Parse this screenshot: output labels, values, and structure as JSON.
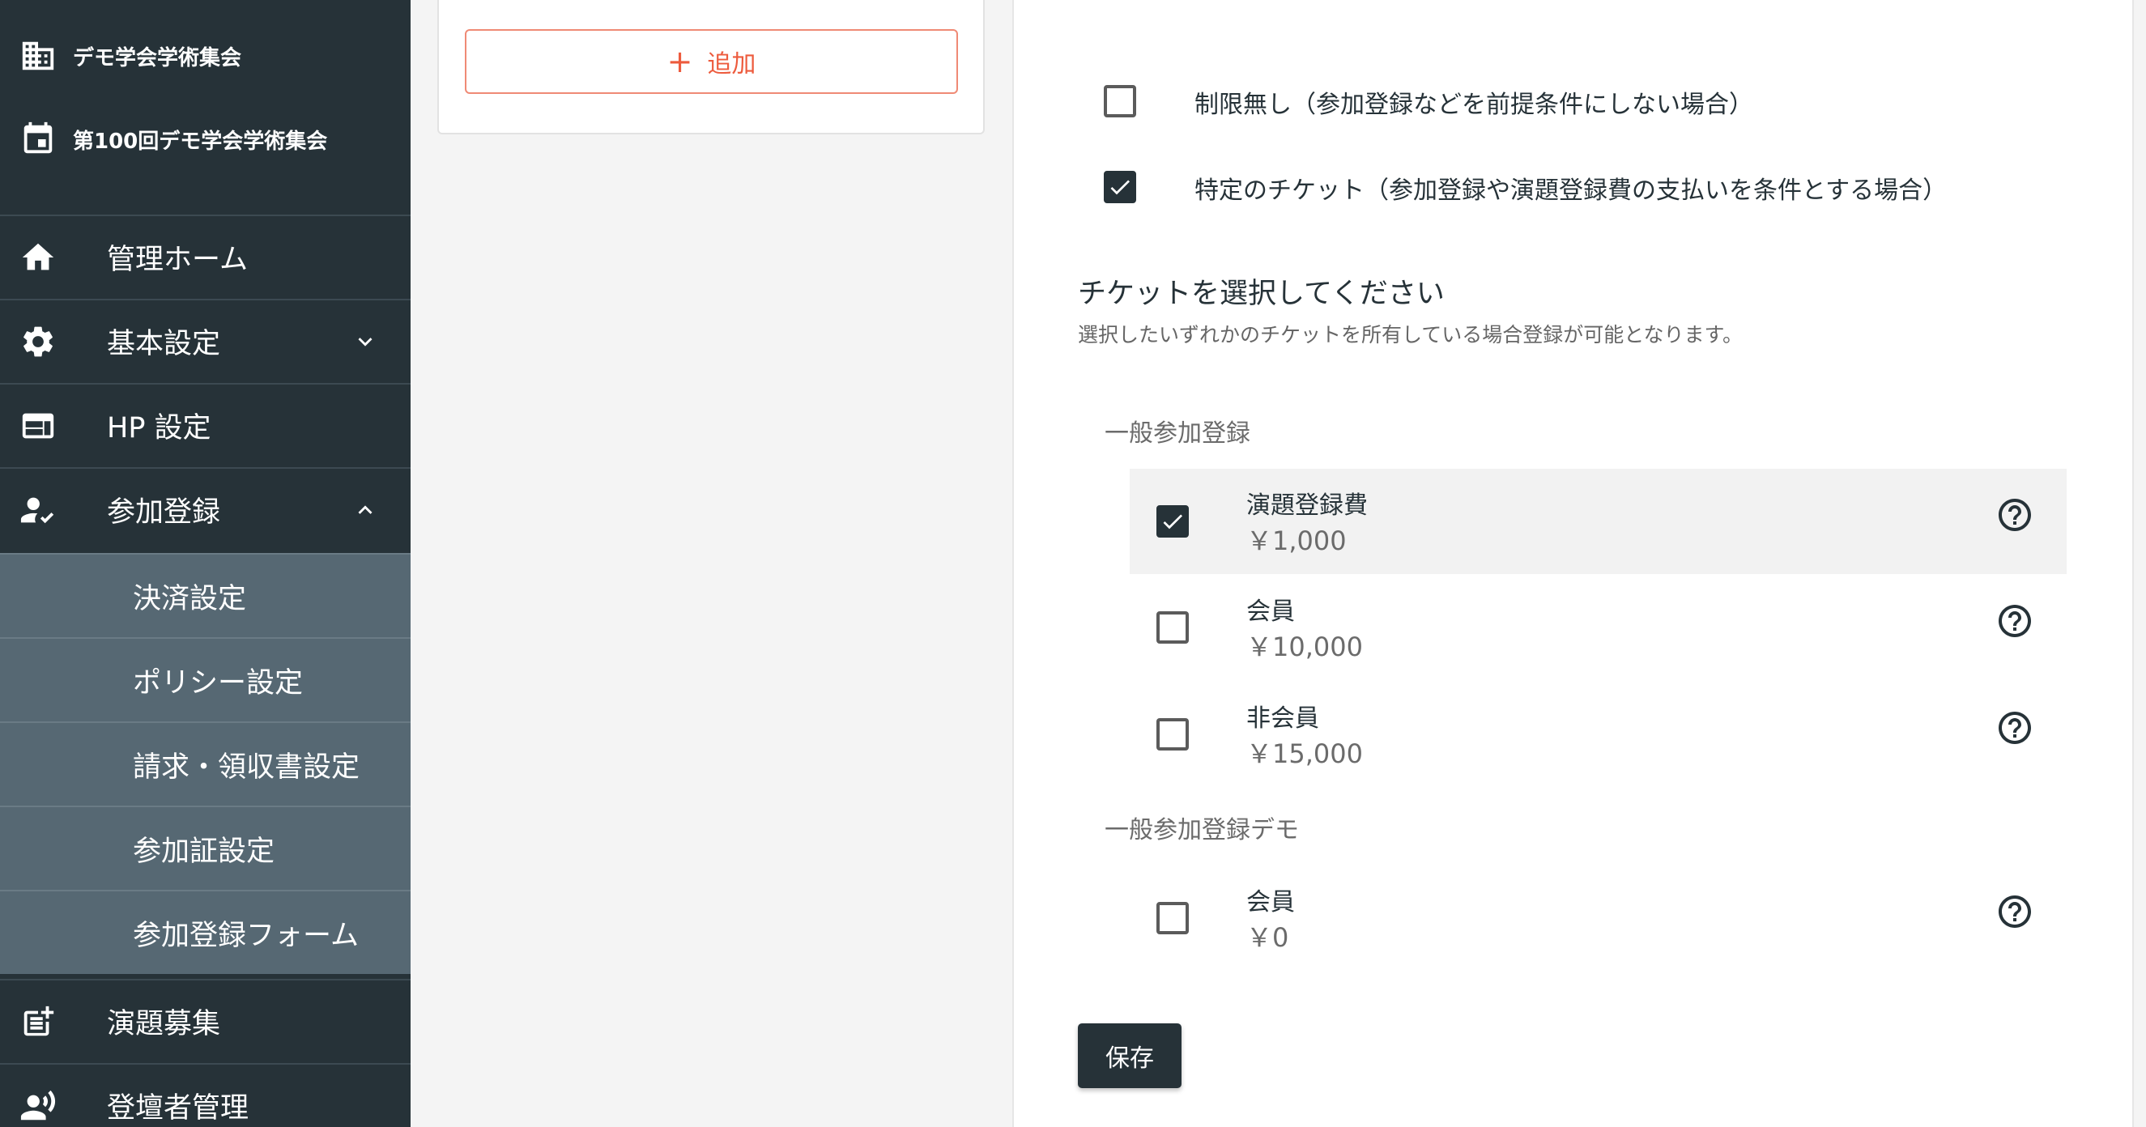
{
  "sidebar": {
    "org_name": "デモ学会学術集会",
    "event_name": "第100回デモ学会学術集会",
    "items": [
      {
        "label": "管理ホーム",
        "icon": "home-icon"
      },
      {
        "label": "基本設定",
        "icon": "gear-icon",
        "chevron": "chevron-down-icon"
      },
      {
        "label": "HP 設定",
        "icon": "web-layout-icon"
      },
      {
        "label": "参加登録",
        "icon": "person-check-icon",
        "chevron": "chevron-up-icon"
      },
      {
        "label": "演題募集",
        "icon": "post-add-icon"
      },
      {
        "label": "登壇者管理",
        "icon": "speaker-group-icon"
      }
    ],
    "sub_items": [
      {
        "label": "決済設定"
      },
      {
        "label": "ポリシー設定"
      },
      {
        "label": "請求・領収書設定"
      },
      {
        "label": "参加証設定"
      },
      {
        "label": "参加登録フォーム"
      }
    ]
  },
  "left_card": {
    "add_label": "追加"
  },
  "main": {
    "options": [
      {
        "label": "制限無し（参加登録などを前提条件にしない場合）",
        "checked": false
      },
      {
        "label": "特定のチケット（参加登録や演題登録費の支払いを条件とする場合）",
        "checked": true
      }
    ],
    "section_title": "チケットを選択してください",
    "section_desc": "選択したいずれかのチケットを所有している場合登録が可能となります。",
    "groups": [
      {
        "name": "一般参加登録",
        "tickets": [
          {
            "name": "演題登録費",
            "price": "￥1,000",
            "checked": true
          },
          {
            "name": "会員",
            "price": "￥10,000",
            "checked": false
          },
          {
            "name": "非会員",
            "price": "￥15,000",
            "checked": false
          }
        ]
      },
      {
        "name": "一般参加登録デモ",
        "tickets": [
          {
            "name": "会員",
            "price": "￥0",
            "checked": false
          }
        ]
      }
    ],
    "save_label": "保存"
  },
  "colors": {
    "sidebar_bg": "#263238",
    "sidebar_sub_bg": "#566873",
    "accent": "#ed5b3d",
    "primary": "#263238"
  }
}
